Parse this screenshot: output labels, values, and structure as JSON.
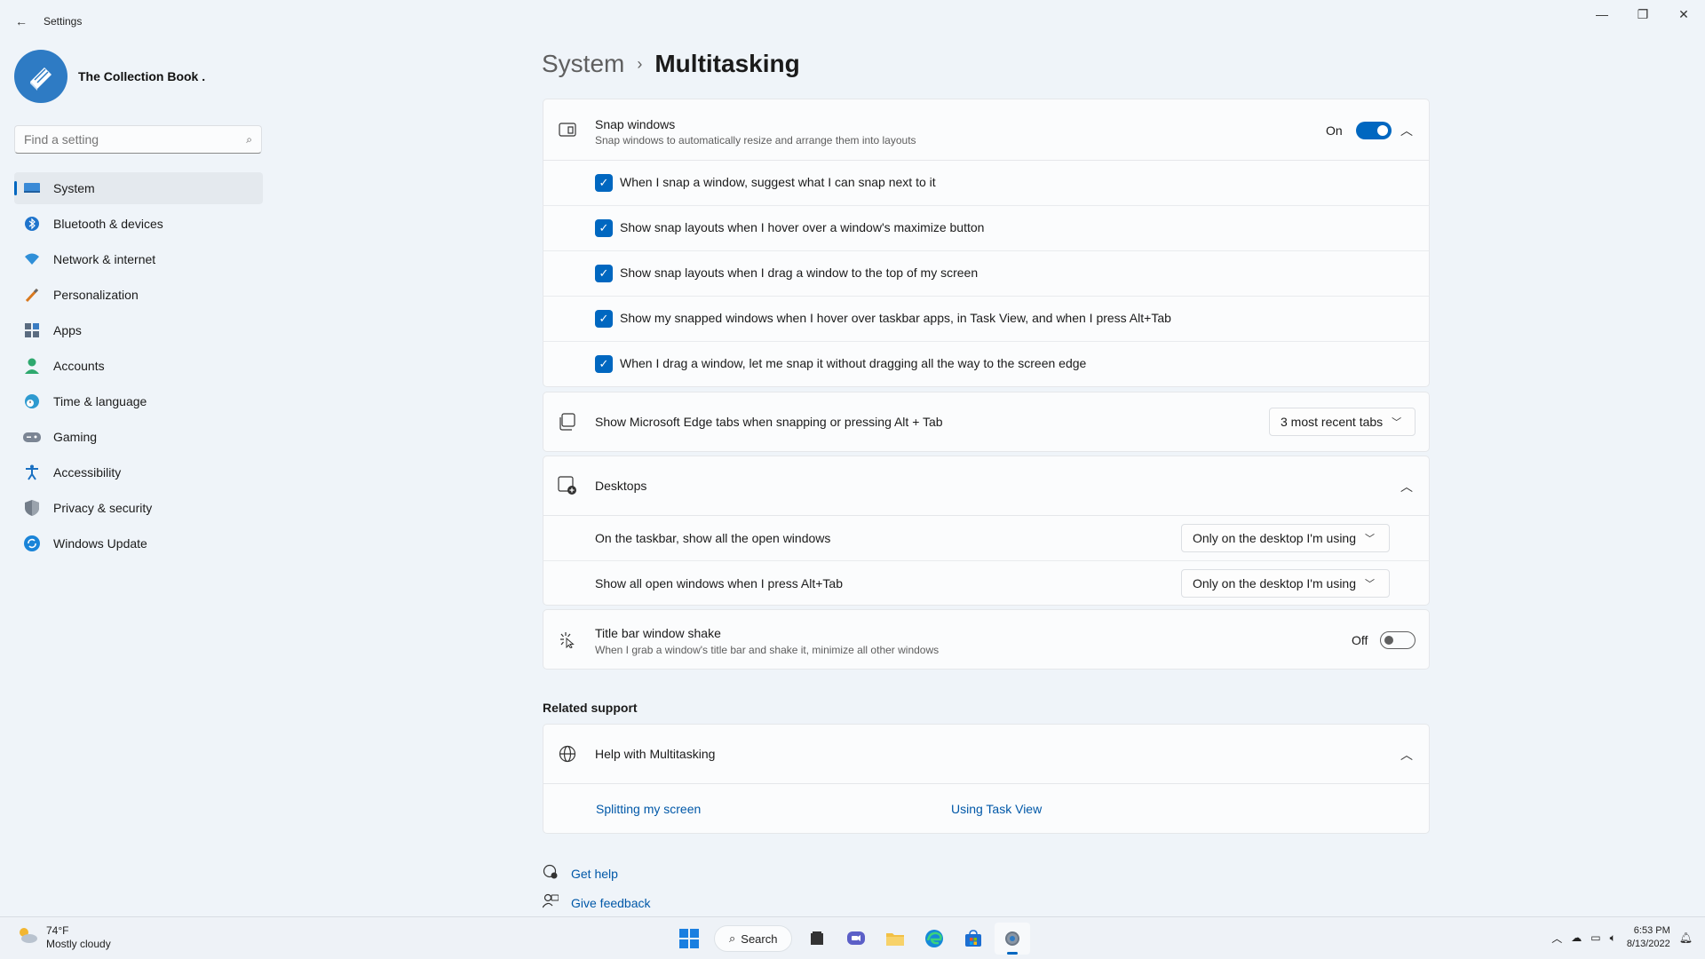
{
  "window": {
    "title": "Settings",
    "back_icon": "←",
    "minimize_icon": "—",
    "maximize_icon": "❐",
    "close_icon": "✕"
  },
  "profile": {
    "name": "The Collection Book ."
  },
  "search": {
    "placeholder": "Find a setting"
  },
  "sidebar": {
    "items": [
      {
        "label": "System",
        "icon": "▭",
        "color": "#2e7bc4"
      },
      {
        "label": "Bluetooth & devices",
        "icon": "✱",
        "color": "#0067c0"
      },
      {
        "label": "Network & internet",
        "icon": "◆",
        "color": "#2f8fd8"
      },
      {
        "label": "Personalization",
        "icon": "✎",
        "color": "#d9791f"
      },
      {
        "label": "Apps",
        "icon": "▦",
        "color": "#5a6b80"
      },
      {
        "label": "Accounts",
        "icon": "●",
        "color": "#2ea86e"
      },
      {
        "label": "Time & language",
        "icon": "◔",
        "color": "#2e9ad0"
      },
      {
        "label": "Gaming",
        "icon": "◉",
        "color": "#6c7787"
      },
      {
        "label": "Accessibility",
        "icon": "✦",
        "color": "#1a70c2"
      },
      {
        "label": "Privacy & security",
        "icon": "⛊",
        "color": "#737d89"
      },
      {
        "label": "Windows Update",
        "icon": "⟳",
        "color": "#1a84d8"
      }
    ]
  },
  "breadcrumb": {
    "parent": "System",
    "separator": "›",
    "current": "Multitasking"
  },
  "snap": {
    "title": "Snap windows",
    "subtitle": "Snap windows to automatically resize and arrange them into layouts",
    "state_label": "On",
    "options": [
      "When I snap a window, suggest what I can snap next to it",
      "Show snap layouts when I hover over a window's maximize button",
      "Show snap layouts when I drag a window to the top of my screen",
      "Show my snapped windows when I hover over taskbar apps, in Task View, and when I press Alt+Tab",
      "When I drag a window, let me snap it without dragging all the way to the screen edge"
    ]
  },
  "edge_tabs": {
    "title": "Show Microsoft Edge tabs when snapping or pressing Alt + Tab",
    "value": "3 most recent tabs"
  },
  "desktops": {
    "title": "Desktops",
    "taskbar_label": "On the taskbar, show all the open windows",
    "taskbar_value": "Only on the desktop I'm using",
    "alttab_label": "Show all open windows when I press Alt+Tab",
    "alttab_value": "Only on the desktop I'm using"
  },
  "shake": {
    "title": "Title bar window shake",
    "subtitle": "When I grab a window's title bar and shake it, minimize all other windows",
    "state_label": "Off"
  },
  "related": {
    "heading": "Related support",
    "help_title": "Help with Multitasking",
    "links": [
      "Splitting my screen",
      "Using Task View"
    ]
  },
  "footer": {
    "get_help": "Get help",
    "give_feedback": "Give feedback"
  },
  "taskbar": {
    "temp": "74°F",
    "weather": "Mostly cloudy",
    "search_label": "Search",
    "time": "6:53 PM",
    "date": "8/13/2022"
  }
}
